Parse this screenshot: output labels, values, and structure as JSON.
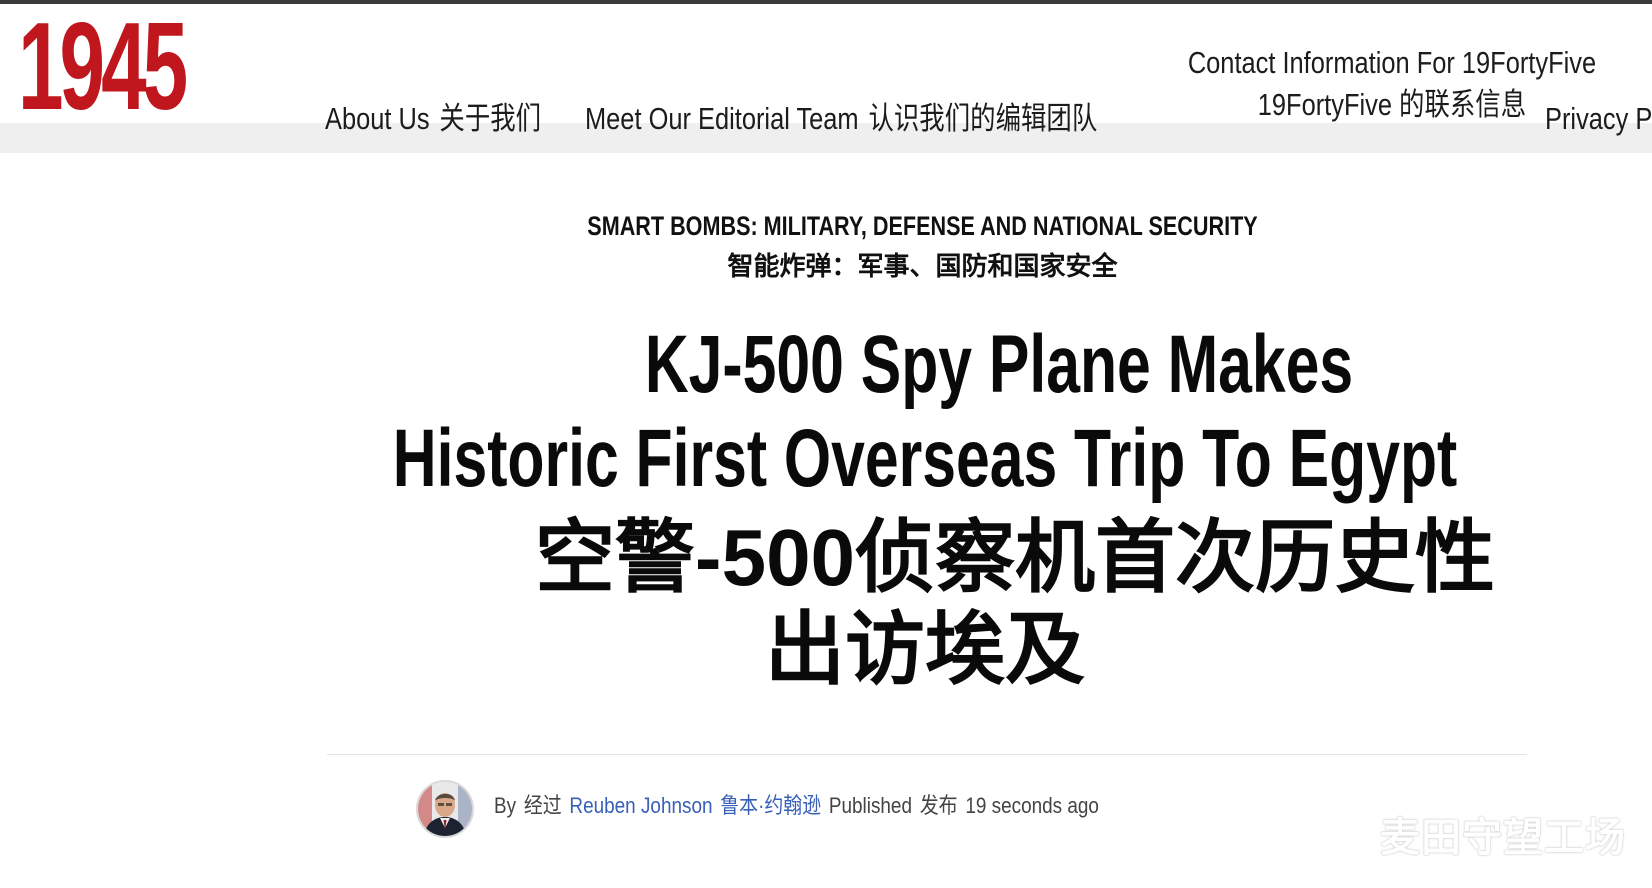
{
  "brand": {
    "logo_text": "1945",
    "logo_color": "#c0161d"
  },
  "nav": {
    "about_en": "About Us",
    "about_zh": "关于我们",
    "team_en": "Meet Our Editorial Team",
    "team_zh": "认识我们的编辑团队",
    "contact_en": "Contact Information For 19FortyFive",
    "contact_zh": "19FortyFive 的联系信息",
    "privacy_en": "Privacy Po"
  },
  "article": {
    "category_en": "SMART BOMBS: MILITARY, DEFENSE AND NATIONAL SECURITY",
    "category_zh": "智能炸弹：军事、国防和国家安全",
    "title_en_line1": "KJ-500 Spy Plane Makes",
    "title_en_line2": "Historic First Overseas Trip To Egypt",
    "title_zh_line1": "空警-500侦察机首次历史性",
    "title_zh_line2": "出访埃及",
    "byline": {
      "by_en": "By",
      "by_zh": "经过",
      "author_en": "Reuben Johnson",
      "author_zh": "鲁本·约翰逊",
      "published_en": "Published",
      "published_zh": "发布",
      "time": "19 seconds ago"
    }
  },
  "watermark": {
    "text": "麦田守望工场"
  },
  "colors": {
    "link_blue": "#3860b8",
    "nav_band": "#efefef",
    "top_strip": "#3a3a3a"
  }
}
